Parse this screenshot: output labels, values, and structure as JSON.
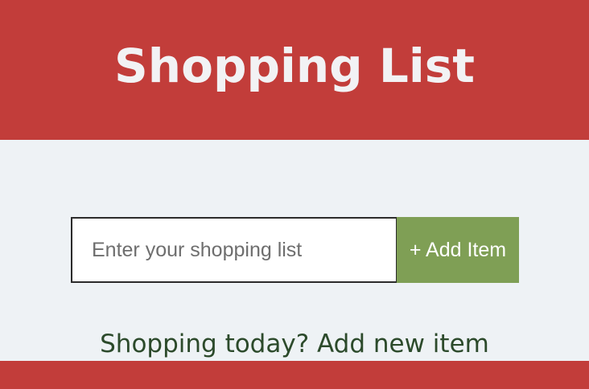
{
  "header": {
    "title": "Shopping List"
  },
  "form": {
    "input_placeholder": "Enter your shopping list",
    "input_value": "",
    "add_button_label": "+ Add Item"
  },
  "main": {
    "empty_message": "Shopping today? Add new item"
  },
  "colors": {
    "brand_red": "#c23d3a",
    "add_button_green": "#7f9f55",
    "background": "#eef2f5",
    "message_text": "#2c4a2b"
  }
}
